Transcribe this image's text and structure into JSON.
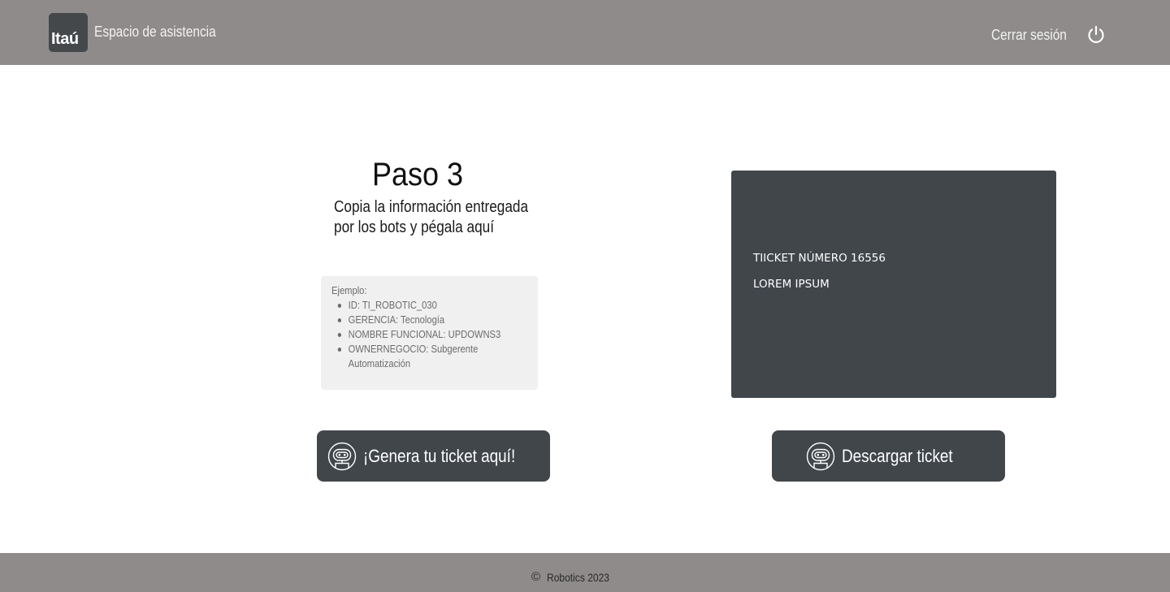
{
  "header": {
    "logo_text": "Itaú",
    "app_title": "Espacio de asistencia",
    "logout_label": "Cerrar sesión",
    "logout_icon": "power-icon"
  },
  "step": {
    "title": "Paso 3",
    "description": "Copia la información entregada por los bots y pégala aquí"
  },
  "example": {
    "label": "Ejemplo:",
    "items": [
      "ID: TI_ROBOTIC_030",
      "GERENCIA: Tecnología",
      "NOMBRE FUNCIONAL: UPDOWNS3",
      "OWNERNEGOCIO: Subgerente Automatización"
    ]
  },
  "ticket": {
    "line1": "TIICKET NÚMERO 16556",
    "line2": "LOREM IPSUM"
  },
  "buttons": {
    "generate_label": "¡Genera tu ticket aquí!",
    "download_label": "Descargar ticket",
    "icon": "robot-icon"
  },
  "footer": {
    "copyright_symbol": "©",
    "text": "Robotics 2023"
  },
  "colors": {
    "header_bg": "#8e8b8a",
    "dark": "#41464b",
    "example_bg": "#f0f0f0"
  }
}
